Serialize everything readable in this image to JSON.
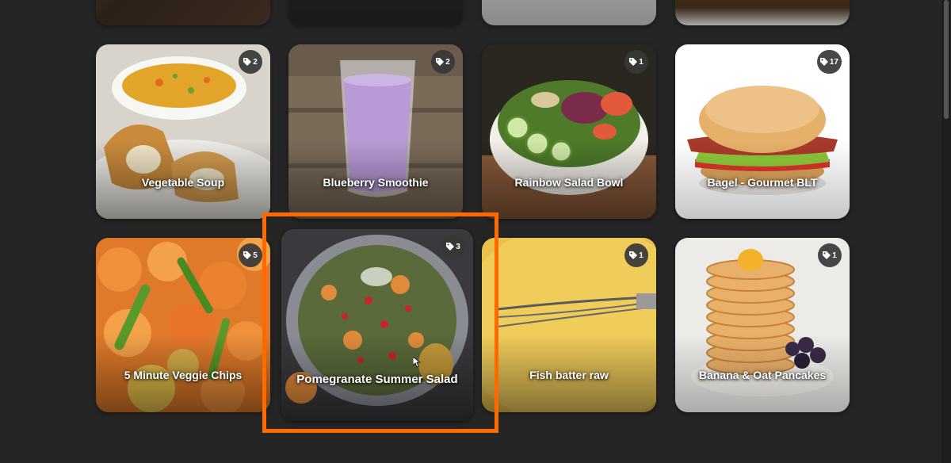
{
  "top_row_cards": [
    {
      "name": "card-top-1"
    },
    {
      "name": "card-top-2"
    },
    {
      "name": "card-top-3"
    },
    {
      "name": "card-top-4"
    }
  ],
  "cards": [
    {
      "title": "Vegetable Soup",
      "tag_count": "2"
    },
    {
      "title": "Blueberry Smoothie",
      "tag_count": "2"
    },
    {
      "title": "Rainbow Salad Bowl",
      "tag_count": "1"
    },
    {
      "title": "Bagel - Gourmet BLT",
      "tag_count": "17"
    },
    {
      "title": "5 Minute Veggie Chips",
      "tag_count": "5"
    },
    {
      "title": "Pomegranate Summer Salad",
      "tag_count": "3"
    },
    {
      "title": "Fish batter raw",
      "tag_count": "1"
    },
    {
      "title": "Banana & Oat Pancakes",
      "tag_count": "1"
    }
  ],
  "icons": {
    "badge": "tag-icon"
  },
  "colors": {
    "background": "#252525",
    "selection": "#ff6a00",
    "badge": "#373737"
  }
}
